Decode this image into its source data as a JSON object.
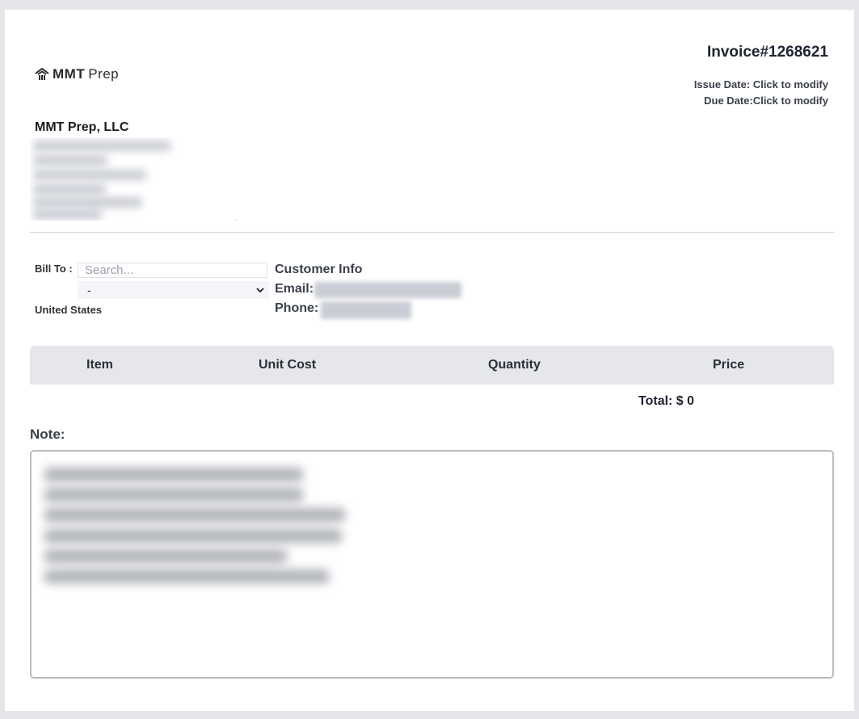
{
  "brand": {
    "logo_bold": "MMT",
    "logo_light": "Prep",
    "company_name": "MMT Prep, LLC"
  },
  "invoice": {
    "number": "Invoice#1268621",
    "issue_label": "Issue Date:",
    "issue_value": "Click to modify",
    "due_label": "Due Date:",
    "due_value": "Click to modify"
  },
  "bill_to": {
    "label": "Bill To :",
    "search_placeholder": "Search...",
    "selected": "-",
    "country": "United States"
  },
  "customer": {
    "title": "Customer Info",
    "email_label": "Email:",
    "phone_label": "Phone:"
  },
  "table": {
    "columns": [
      "Item",
      "Unit Cost",
      "Quantity",
      "Price"
    ],
    "total": "Total: $ 0"
  },
  "note": {
    "label": "Note:"
  },
  "icons": {
    "logo": "house-icon",
    "select": "chevron-down-icon",
    "resize": "resize-grip-icon"
  }
}
